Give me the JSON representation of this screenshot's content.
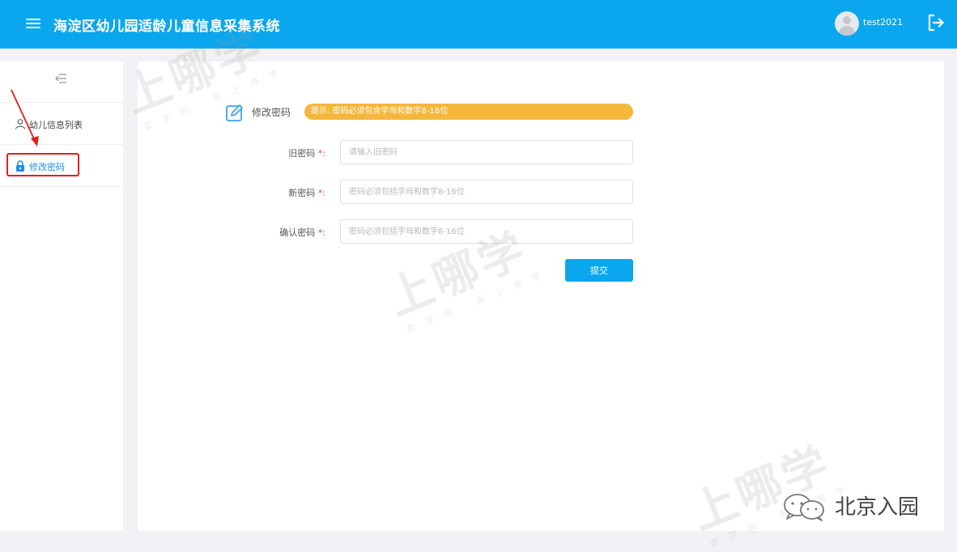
{
  "header": {
    "title": "海淀区幼儿园适龄儿童信息采集系统",
    "username": "test2021"
  },
  "sidebar": {
    "items": [
      {
        "label": "幼儿信息列表"
      },
      {
        "label": "修改密码",
        "active": true
      }
    ]
  },
  "form": {
    "title": "修改密码",
    "tip": "提示: 密码必须包含字母和数字8-16位",
    "fields": [
      {
        "label": "旧密码",
        "required_mark": "*:",
        "placeholder": "请输入旧密码",
        "value": ""
      },
      {
        "label": "新密码",
        "required_mark": "*:",
        "placeholder": "密码必须包括字母和数字8-16位",
        "value": ""
      },
      {
        "label": "确认密码",
        "required_mark": "*:",
        "placeholder": "密码必须包括字母和数字8-16位",
        "value": ""
      }
    ],
    "submit_label": "提交"
  },
  "watermark": {
    "brand": "上哪学",
    "tagline": "查学校 用上哪学"
  },
  "footer_badge": {
    "text": "北京入园"
  },
  "colors": {
    "header": "#0aa7ef",
    "tip": "#f5b73b",
    "active": "#1d8ee6",
    "highlight": "#e0201c"
  }
}
